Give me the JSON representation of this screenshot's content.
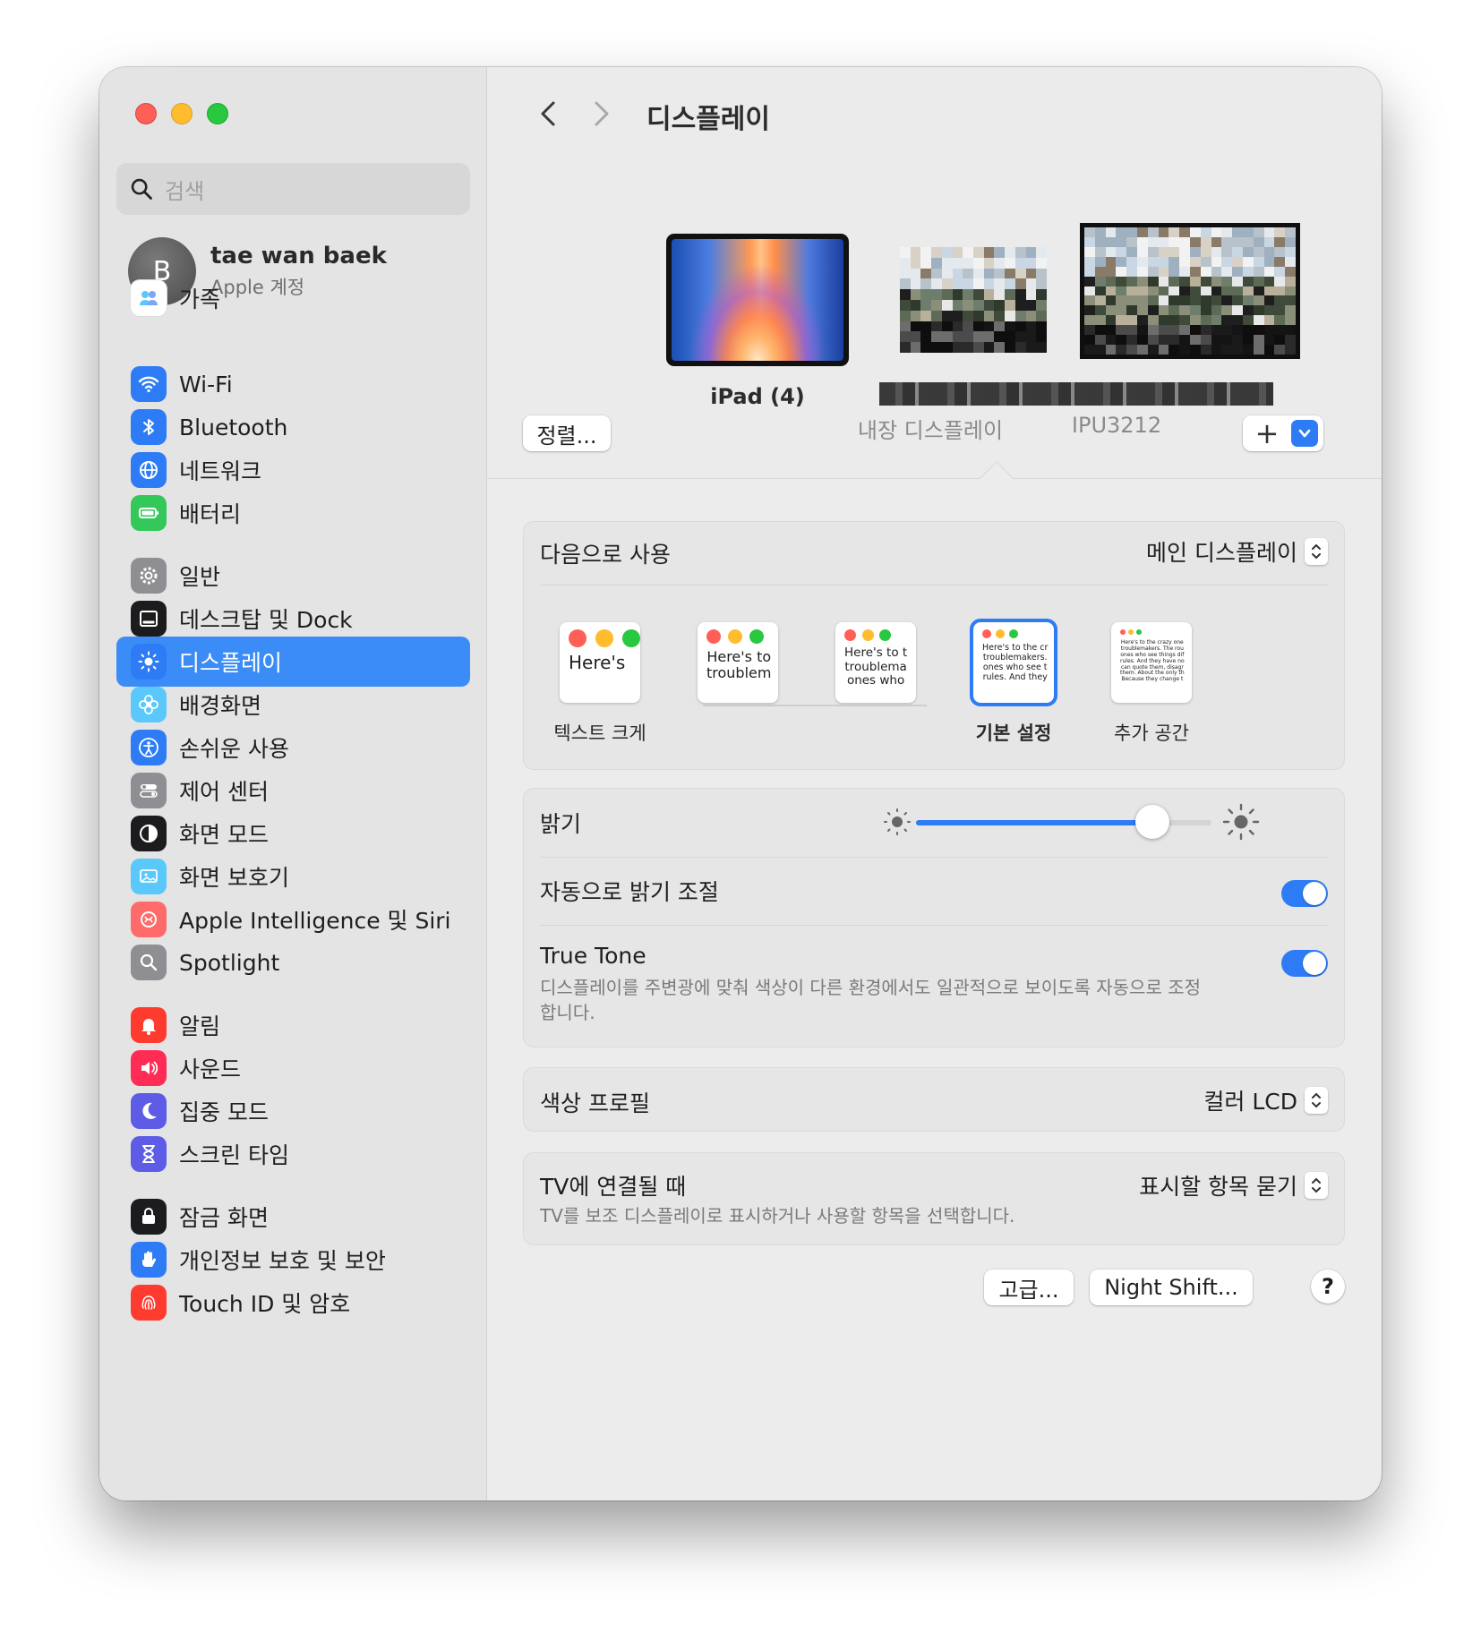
{
  "sidebar": {
    "search_placeholder": "검색",
    "account": {
      "initial": "B",
      "name": "tae wan baek",
      "subtitle": "Apple 계정"
    },
    "family_label": "가족",
    "items": [
      {
        "label": "Wi-Fi",
        "icon": "wifi-icon",
        "color": "#2d7cf6"
      },
      {
        "label": "Bluetooth",
        "icon": "bluetooth-icon",
        "color": "#2d7cf6"
      },
      {
        "label": "네트워크",
        "icon": "globe-icon",
        "color": "#2d7cf6"
      },
      {
        "label": "배터리",
        "icon": "battery-icon",
        "color": "#34c759"
      },
      {
        "label": "일반",
        "icon": "gear-icon",
        "color": "#8e8e93"
      },
      {
        "label": "데스크탑 및 Dock",
        "icon": "dock-icon",
        "color": "#1c1c1e"
      },
      {
        "label": "디스플레이",
        "icon": "sun-icon",
        "color": "#2d7cf6",
        "active": true
      },
      {
        "label": "배경화면",
        "icon": "flower-icon",
        "color": "#5ac8fa"
      },
      {
        "label": "손쉬운 사용",
        "icon": "accessibility-icon",
        "color": "#2d7cf6"
      },
      {
        "label": "제어 센터",
        "icon": "toggles-icon",
        "color": "#8e8e93"
      },
      {
        "label": "화면 모드",
        "icon": "appearance-icon",
        "color": "#1c1c1e"
      },
      {
        "label": "화면 보호기",
        "icon": "screensaver-icon",
        "color": "#5ac8fa"
      },
      {
        "label": "Apple Intelligence 및 Siri",
        "icon": "siri-icon",
        "color": "#ff6b6b"
      },
      {
        "label": "Spotlight",
        "icon": "magnifier-icon",
        "color": "#8e8e93"
      },
      {
        "label": "알림",
        "icon": "bell-icon",
        "color": "#ff3b30"
      },
      {
        "label": "사운드",
        "icon": "speaker-icon",
        "color": "#ff2d55"
      },
      {
        "label": "집중 모드",
        "icon": "moon-icon",
        "color": "#5e5ce6"
      },
      {
        "label": "스크린 타임",
        "icon": "hourglass-icon",
        "color": "#5e5ce6"
      },
      {
        "label": "잠금 화면",
        "icon": "lock-icon",
        "color": "#1c1c1e"
      },
      {
        "label": "개인정보 보호 및 보안",
        "icon": "hand-icon",
        "color": "#2d7cf6"
      },
      {
        "label": "Touch ID 및 암호",
        "icon": "fingerprint-icon",
        "color": "#ff3b30"
      }
    ]
  },
  "header": {
    "title": "디스플레이"
  },
  "displays": {
    "arrange_button": "정렬...",
    "ipad_label": "iPad (4)",
    "builtin_label": "내장 디스플레이",
    "external_label": "IPU3212",
    "add_button": "+"
  },
  "use_as": {
    "label": "다음으로 사용",
    "value": "메인 디스플레이"
  },
  "text_size": {
    "options": [
      {
        "label": "텍스트 크게",
        "preview": "Here's"
      },
      {
        "label": "",
        "preview": "Here's to\ntroublem"
      },
      {
        "label": "",
        "preview": "Here's to t\ntroublema\nones who"
      },
      {
        "label": "기본 설정",
        "preview": "Here's to the cr\ntroublemakers.\nones who see t\nrules. And they"
      },
      {
        "label": "추가 공간",
        "preview": "Here's to the crazy one\ntroublemakers. The rou\nones who see things dif\nrules. And they have no\ncan quote them, disagr\nthem. About the only th\nBecause they change t"
      }
    ],
    "selected_index": 3
  },
  "brightness": {
    "label": "밝기",
    "level": 0.8
  },
  "auto_brightness": {
    "label": "자동으로 밝기 조절",
    "on": true
  },
  "true_tone": {
    "label": "True Tone",
    "description": "디스플레이를 주변광에 맞춰 색상이 다른 환경에서도 일관적으로 보이도록 자동으로 조정합니다.",
    "on": true
  },
  "color_profile": {
    "label": "색상 프로필",
    "value": "컬러 LCD"
  },
  "tv": {
    "label": "TV에 연결될 때",
    "description": "TV를 보조 디스플레이로 표시하거나 사용할 항목을 선택합니다.",
    "value": "표시할 항목 묻기"
  },
  "footer": {
    "advanced_button": "고급...",
    "night_shift_button": "Night Shift...",
    "help_button": "?"
  },
  "colors": {
    "accent": "#2d7cf6",
    "sidebar_active": "#3b8cf7"
  }
}
